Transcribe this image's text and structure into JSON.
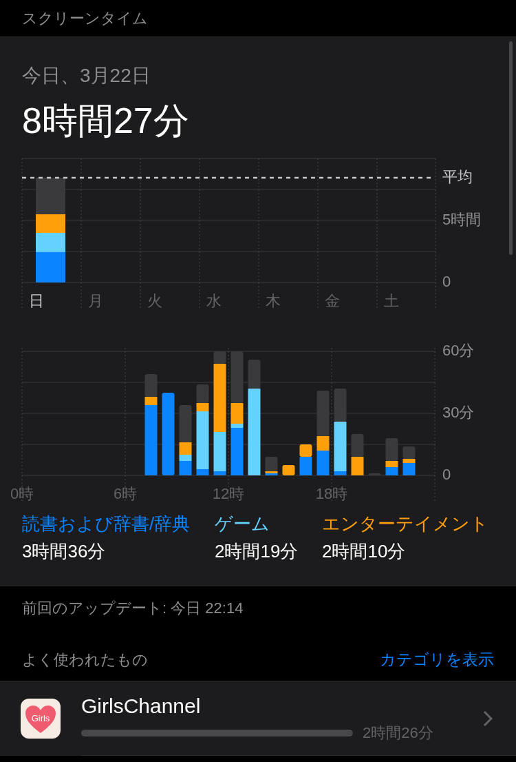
{
  "header": {
    "title": "スクリーンタイム"
  },
  "summary": {
    "date": "今日、3月22日",
    "total": "8時間27分"
  },
  "weekly_chart": {
    "chart_data": {
      "type": "bar",
      "stacked": true,
      "grid": true,
      "categories": [
        "日",
        "月",
        "火",
        "水",
        "木",
        "金",
        "土"
      ],
      "ylim": [
        0,
        10
      ],
      "yticks": [
        {
          "value": 0,
          "label": "0"
        },
        {
          "value": 5,
          "label": "5時間"
        }
      ],
      "ref_lines": [
        {
          "axis": "y",
          "value": 8.45,
          "label": "平均"
        }
      ],
      "series": [
        {
          "name": "読書および辞書/辞典",
          "color": "#0a84ff",
          "values": [
            2.45,
            0,
            0,
            0,
            0,
            0,
            0
          ]
        },
        {
          "name": "ゲーム",
          "color": "#64d2ff",
          "values": [
            1.55,
            0,
            0,
            0,
            0,
            0,
            0
          ]
        },
        {
          "name": "エンターテイメント",
          "color": "#ff9f0a",
          "values": [
            1.5,
            0,
            0,
            0,
            0,
            0,
            0
          ]
        },
        {
          "color": "#3a3a3c",
          "values": [
            2.95,
            0,
            0,
            0,
            0,
            0,
            0
          ]
        }
      ]
    }
  },
  "hourly_chart": {
    "chart_data": {
      "type": "bar",
      "stacked": true,
      "grid": true,
      "x": [
        7.5,
        8.5,
        9.5,
        10.5,
        11.5,
        12.5,
        13.5,
        14.5,
        15.5,
        16.5,
        17.5,
        18.5,
        19.5,
        20.5,
        21.5,
        22.5
      ],
      "xlim": [
        0,
        24
      ],
      "ylim": [
        0,
        60
      ],
      "xticks": [
        {
          "value": 0,
          "label": "0時"
        },
        {
          "value": 6,
          "label": "6時"
        },
        {
          "value": 12,
          "label": "12時"
        },
        {
          "value": 18,
          "label": "18時"
        }
      ],
      "yticks": [
        {
          "value": 0,
          "label": "0"
        },
        {
          "value": 30,
          "label": "30分"
        },
        {
          "value": 60,
          "label": "60分"
        }
      ],
      "series": [
        {
          "color": "#0a84ff",
          "values": [
            34,
            40,
            7,
            3,
            2,
            23,
            0,
            1,
            0,
            9,
            12,
            2,
            0,
            0,
            4,
            6
          ]
        },
        {
          "color": "#64d2ff",
          "values": [
            0,
            0,
            3,
            28,
            19,
            2,
            42,
            0,
            0,
            0,
            0,
            24,
            0,
            0,
            0,
            0
          ]
        },
        {
          "color": "#ff9f0a",
          "values": [
            4,
            0,
            6,
            4,
            33,
            10,
            0,
            1,
            5,
            6,
            7,
            0,
            9,
            0,
            3,
            2
          ]
        },
        {
          "color": "#3a3a3c",
          "values": [
            11,
            0,
            18,
            9,
            6,
            25,
            14,
            7,
            0,
            0,
            22,
            16,
            11,
            1,
            11,
            6
          ]
        }
      ]
    }
  },
  "category_totals": [
    "3時間36分",
    "2時間19分",
    "2時間10分"
  ],
  "last_update": "前回のアップデート: 今日 22:14",
  "most_used": {
    "title": "よく使われたもの",
    "action": "カテゴリを表示",
    "apps": [
      {
        "name": "GirlsChannel",
        "icon_text": "Girls",
        "time": "2時間26分"
      }
    ]
  }
}
